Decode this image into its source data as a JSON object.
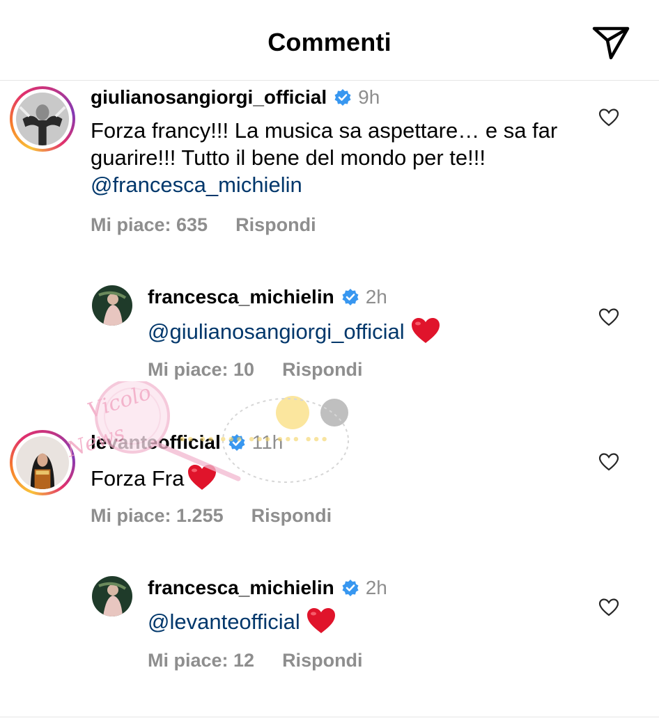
{
  "header": {
    "title": "Commenti",
    "send_icon": "paper-plane-icon"
  },
  "comments": [
    {
      "username": "giulianosangiorgi_official",
      "time": "9h",
      "text": "Forza francy!!! La musica sa aspettare… e sa far guarire!!! Tutto il bene del mondo per te!!!",
      "mention": "@francesca_michielin",
      "likes": "Mi piace: 635",
      "reply": "Rispondi"
    },
    {
      "username": "francesca_michielin",
      "time": "2h",
      "mention": "@giulianosangiorgi_official",
      "likes": "Mi piace: 10",
      "reply": "Rispondi"
    },
    {
      "username": "levanteofficial",
      "time": "11h",
      "text": "Forza Fra",
      "likes": "Mi piace: 1.255",
      "reply": "Rispondi"
    },
    {
      "username": "francesca_michielin",
      "time": "2h",
      "mention": "@levanteofficial",
      "likes": "Mi piace: 12",
      "reply": "Rispondi"
    }
  ],
  "watermark_text": "Vicolo delle News",
  "colors": {
    "mention": "#00376b",
    "secondary": "#8e8e8e",
    "verified": "#3897f0",
    "heart": "#e0142b"
  }
}
